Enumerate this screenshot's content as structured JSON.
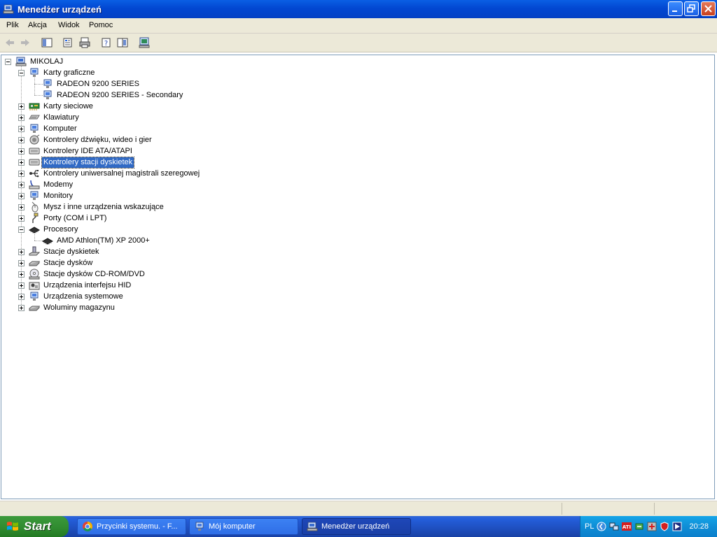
{
  "window": {
    "title": "Menedżer urządzeń"
  },
  "menu": [
    "Plik",
    "Akcja",
    "Widok",
    "Pomoc"
  ],
  "tree": {
    "root": "MIKOLAJ",
    "items": [
      {
        "label": "Karty graficzne",
        "level": 1,
        "expanded": true
      },
      {
        "label": "RADEON 9200 SERIES",
        "level": 2
      },
      {
        "label": "RADEON 9200 SERIES - Secondary",
        "level": 2
      },
      {
        "label": "Karty sieciowe",
        "level": 1
      },
      {
        "label": "Klawiatury",
        "level": 1
      },
      {
        "label": "Komputer",
        "level": 1
      },
      {
        "label": "Kontrolery dźwięku, wideo i gier",
        "level": 1
      },
      {
        "label": "Kontrolery IDE ATA/ATAPI",
        "level": 1
      },
      {
        "label": "Kontrolery stacji dyskietek",
        "level": 1,
        "selected": true
      },
      {
        "label": "Kontrolery uniwersalnej magistrali szeregowej",
        "level": 1
      },
      {
        "label": "Modemy",
        "level": 1
      },
      {
        "label": "Monitory",
        "level": 1
      },
      {
        "label": "Mysz i inne urządzenia wskazujące",
        "level": 1
      },
      {
        "label": "Porty (COM i LPT)",
        "level": 1
      },
      {
        "label": "Procesory",
        "level": 1,
        "expanded": true
      },
      {
        "label": "AMD Athlon(TM) XP 2000+",
        "level": 2
      },
      {
        "label": "Stacje dyskietek",
        "level": 1
      },
      {
        "label": "Stacje dysków",
        "level": 1
      },
      {
        "label": "Stacje dysków CD-ROM/DVD",
        "level": 1
      },
      {
        "label": "Urządzenia interfejsu HID",
        "level": 1
      },
      {
        "label": "Urządzenia systemowe",
        "level": 1
      },
      {
        "label": "Woluminy magazynu",
        "level": 1
      }
    ]
  },
  "taskbar": {
    "start": "Start",
    "tasks": [
      {
        "label": "Przycinki systemu. - F..."
      },
      {
        "label": "Mój komputer"
      },
      {
        "label": "Menedżer urządzeń"
      }
    ],
    "lang": "PL",
    "clock": "20:28"
  },
  "colors": {
    "title": "#0247d2",
    "selection": "#316ac5",
    "chrome": "#ece9d8"
  }
}
